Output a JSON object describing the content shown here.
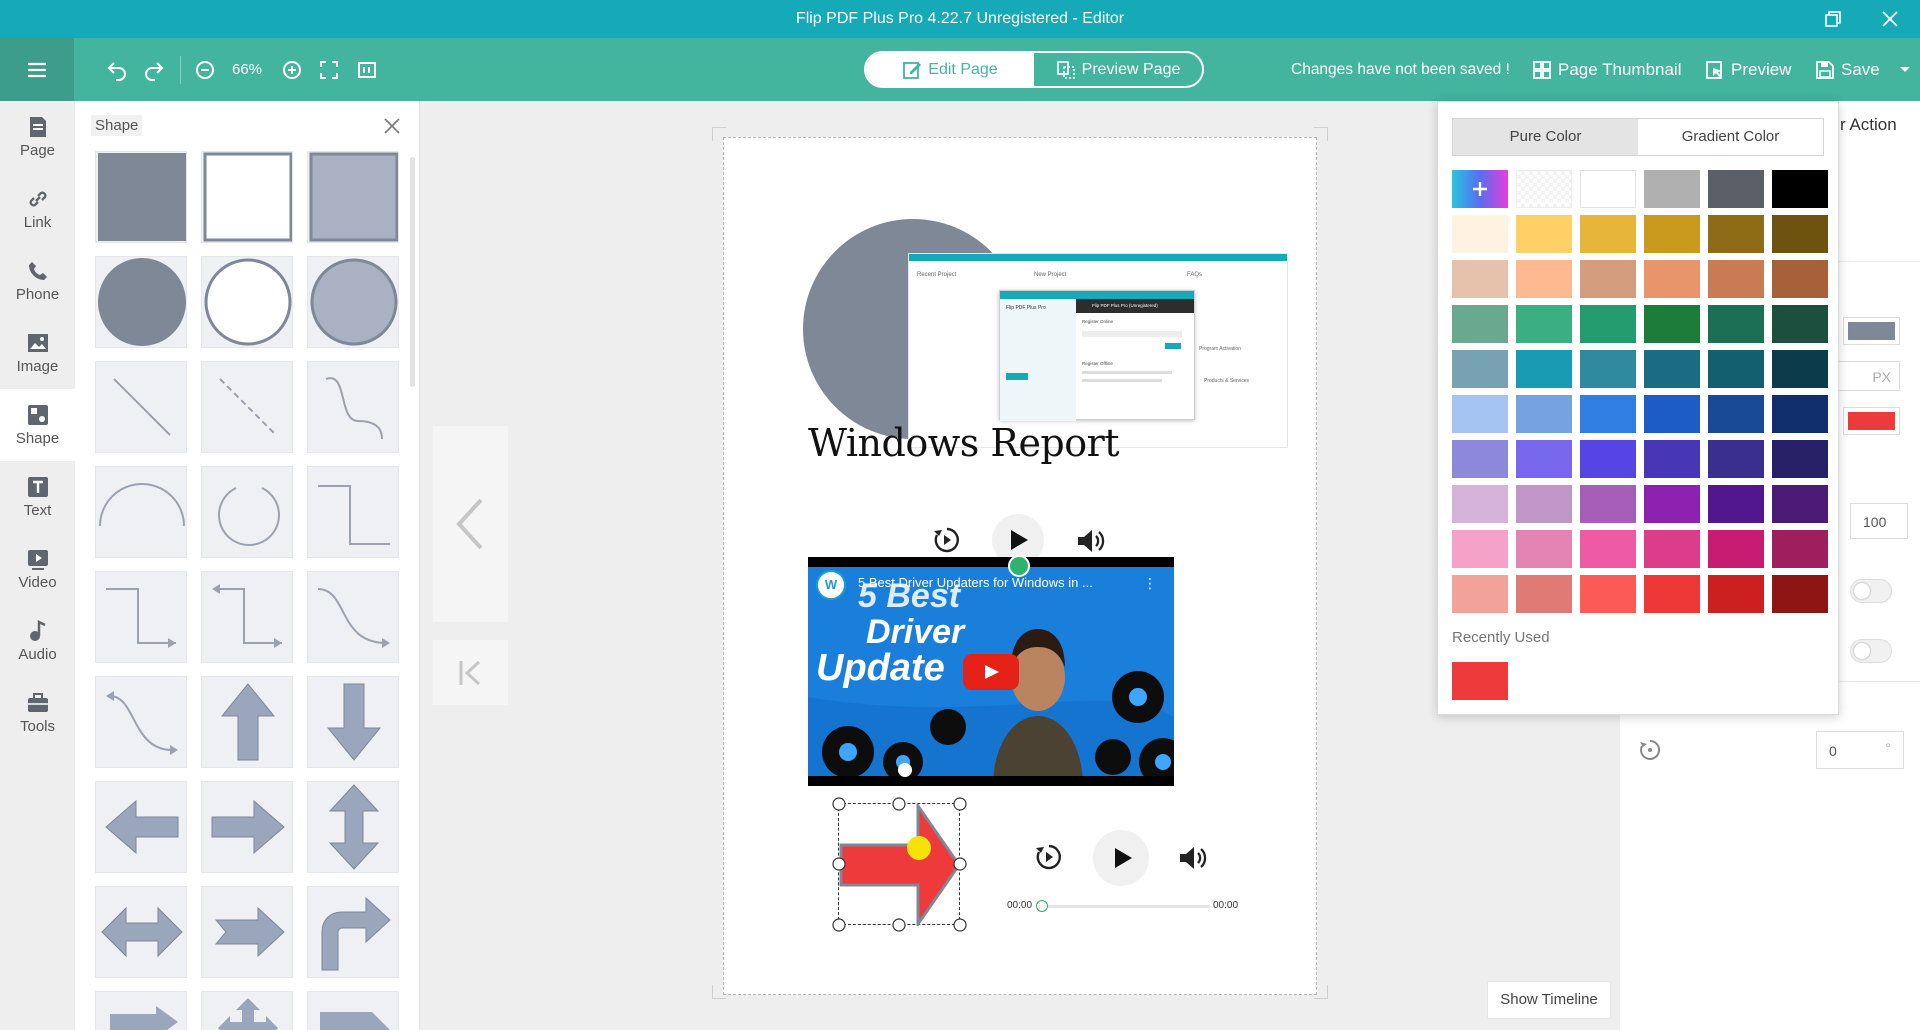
{
  "titlebar": {
    "title": "Flip PDF Plus Pro 4.22.7 Unregistered - Editor"
  },
  "toolbar": {
    "zoom": "66%",
    "edit_page": "Edit Page",
    "preview_page": "Preview Page",
    "unsaved": "Changes have not been saved !",
    "page_thumbnail": "Page Thumbnail",
    "preview": "Preview",
    "save": "Save"
  },
  "nav": [
    {
      "label": "Page",
      "icon": "page-icon"
    },
    {
      "label": "Link",
      "icon": "link-icon"
    },
    {
      "label": "Phone",
      "icon": "phone-icon"
    },
    {
      "label": "Image",
      "icon": "image-icon"
    },
    {
      "label": "Shape",
      "icon": "shape-icon"
    },
    {
      "label": "Text",
      "icon": "text-icon"
    },
    {
      "label": "Video",
      "icon": "video-icon"
    },
    {
      "label": "Audio",
      "icon": "audio-icon"
    },
    {
      "label": "Tools",
      "icon": "tools-icon"
    }
  ],
  "shape_panel": {
    "title": "Shape",
    "shapes": [
      "filled-rectangle",
      "outlined-rectangle",
      "light-rectangle",
      "filled-circle",
      "outlined-circle",
      "light-circle",
      "line",
      "dashed-line",
      "curve",
      "arc",
      "open-circle",
      "step-line",
      "elbow-arrow",
      "double-elbow-arrow",
      "s-curve-arrow",
      "curved-arrow",
      "up-arrow",
      "down-arrow",
      "left-arrow",
      "right-arrow",
      "up-down-arrow",
      "left-right-arrow",
      "notched-right-arrow",
      "bent-up-arrow",
      "right-arrow-small",
      "quad-arrow",
      "pentagon-arrow"
    ]
  },
  "canvas": {
    "heading": "Windows Report",
    "video_title": "5 Best Driver Updaters for Windows in ...",
    "video_text_line1": "5 Best",
    "video_text_line2": "Driver",
    "video_text_line3": "Update",
    "audio_time_start": "00:00",
    "audio_time_end": "00:00",
    "screenshot": {
      "heading_recent": "Recent Project",
      "heading_new": "New Project",
      "heading_faq": "FAQs",
      "dialog_title": "Flip PDF Plus Pro (Unregistered)",
      "register_online": "Register Online",
      "register_offline": "Register Offline",
      "product": "Flip PDF Plus Pro",
      "activation": "Program Activation",
      "products": "Products & Services"
    }
  },
  "show_timeline": "Show Timeline",
  "color_picker": {
    "tab_pure": "Pure Color",
    "tab_gradient": "Gradient Color",
    "recently_used_label": "Recently Used",
    "recent": [
      "#ee3a3a"
    ],
    "rows": [
      [
        "#special-add",
        "#transparent",
        "#ffffff",
        "#b0b0b0",
        "#5b6066",
        "#000000"
      ],
      [
        "#fdf3e0",
        "#fdd165",
        "#e6b53a",
        "#c99a1d",
        "#8d6b17",
        "#6d5210"
      ],
      [
        "#e6c2ad",
        "#ffb990",
        "#d49d7e",
        "#e9956c",
        "#c97b53",
        "#a8603a"
      ],
      [
        "#6aa990",
        "#3caf82",
        "#239b6f",
        "#1c7d3a",
        "#1c6e55",
        "#1d4f3f"
      ],
      [
        "#77a2b3",
        "#189cb3",
        "#2f8aa0",
        "#1a6c84",
        "#135e6f",
        "#0c3c4c"
      ],
      [
        "#a6c4f2",
        "#75a2e0",
        "#2f7fe3",
        "#1d5bc7",
        "#184a96",
        "#122f6d"
      ],
      [
        "#8e88da",
        "#7767ec",
        "#5545e3",
        "#4737b6",
        "#3a2e8e",
        "#272066"
      ],
      [
        "#d4b4d9",
        "#c097c7",
        "#a65fb9",
        "#8e22b0",
        "#52168f",
        "#4a1a74"
      ],
      [
        "#f4a2c8",
        "#e484b3",
        "#ee5ba4",
        "#dd3c8a",
        "#c81b72",
        "#9e1f5d"
      ],
      [
        "#f3a29a",
        "#e07a74",
        "#fb5a57",
        "#ee3737",
        "#cc2020",
        "#8f1414"
      ]
    ]
  },
  "right_panel": {
    "action_label": "r Action",
    "px_label": "PX",
    "value_100": "100",
    "value_0": "0",
    "degree": "°"
  }
}
